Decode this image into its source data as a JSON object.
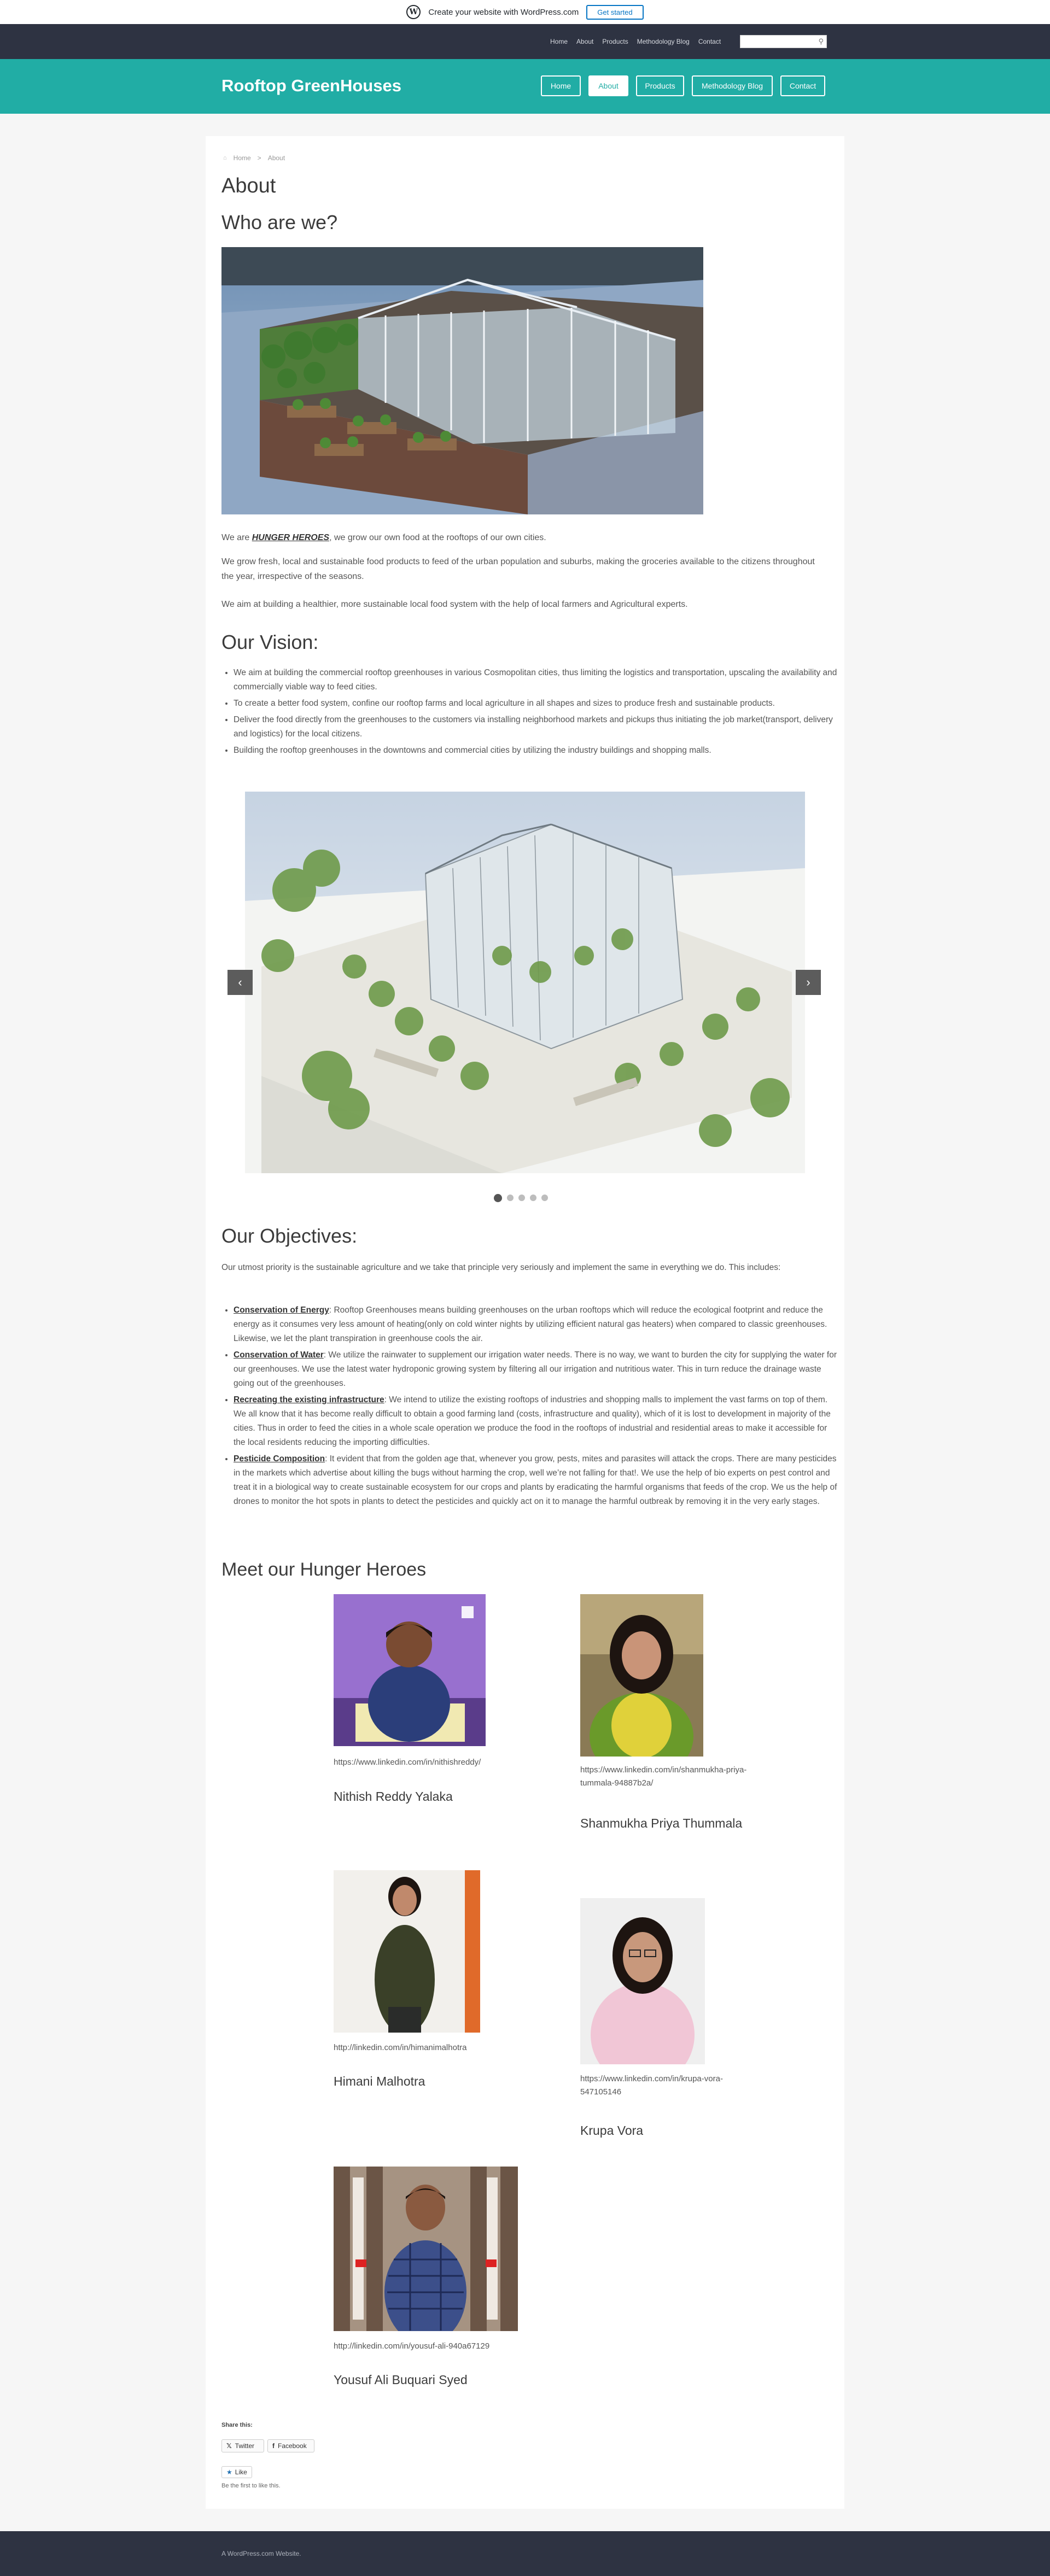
{
  "wpbar": {
    "logo": "W",
    "text": "Create your website with WordPress.com",
    "button": "Get started"
  },
  "topnav": {
    "links": [
      "Home",
      "About",
      "Products",
      "Methodology Blog",
      "Contact"
    ],
    "search_icon": "search-icon"
  },
  "header": {
    "title": "Rooftop GreenHouses",
    "menu": [
      "Home",
      "About",
      "Products",
      "Methodology Blog",
      "Contact"
    ],
    "active": "About"
  },
  "breadcrumb": {
    "home": "Home",
    "separator": ">",
    "current": "About"
  },
  "page": {
    "title": "About",
    "who_heading": "Who are we?",
    "intro_pre": "We are ",
    "intro_strong": "HUNGER HEROES",
    "intro_post": ", we grow our own food at the rooftops of our own cities.",
    "para2": "We grow fresh, local and sustainable food products to feed of the urban population and suburbs, making the groceries available to the citizens throughout the year, irrespective of the seasons.",
    "para3": "We aim at building a healthier, more sustainable local food system with the help of local farmers and Agricultural experts."
  },
  "vision": {
    "heading": "Our Vision:",
    "items": [
      "We aim at building the commercial rooftop greenhouses in various Cosmopolitan cities, thus limiting the logistics and transportation, upscaling the availability and commercially viable way to feed cities.",
      "To create a better food system, confine our rooftop farms and local agriculture in all shapes and sizes to produce fresh and sustainable products.",
      "Deliver the food directly from the greenhouses to the customers via installing neighborhood markets and pickups thus initiating the job market(transport, delivery and logistics) for the local citizens.",
      "Building the rooftop greenhouses in the downtowns and commercial cities by utilizing the industry buildings and shopping malls."
    ]
  },
  "slider": {
    "prev": "‹",
    "next": "›",
    "dots": 5,
    "active_dot": 1
  },
  "objectives": {
    "heading": "Our Objectives:",
    "intro": "Our utmost priority is the sustainable agriculture and we take that principle very seriously and implement the same in everything we do. This includes:",
    "items": [
      {
        "title": "Conservation of Energy",
        "text": ": Rooftop Greenhouses means building greenhouses on the urban rooftops which will reduce the ecological footprint and reduce the energy as it consumes very less amount of heating(only on cold winter nights by utilizing efficient natural gas heaters) when compared to classic greenhouses. Likewise, we let the plant transpiration in greenhouse cools the air."
      },
      {
        "title": "Conservation of Water",
        "text": ": We utilize the rainwater to supplement our irrigation water needs. There is no way, we want to burden the city for supplying the water for our greenhouses. We use the latest water hydroponic growing system by filtering all our irrigation and nutritious water. This in turn reduce the drainage waste going out of the greenhouses."
      },
      {
        "title": "Recreating the existing infrastructure",
        "text": ": We intend to utilize the existing rooftops of industries and shopping malls to implement the vast farms on top of them. We all know that it has become really difficult to obtain a good farming land (costs, infrastructure and quality), which of it is lost to development in majority of the cities. Thus in order to feed the cities in a whole scale operation we produce the food in the rooftops of industrial and residential areas to make it accessible for the local residents reducing the importing difficulties."
      },
      {
        "title": "Pesticide Composition",
        "text": ": It evident that from the golden age that, whenever you grow, pests, mites and parasites will attack the crops. There are many pesticides in the markets which advertise about killing the bugs without harming the crop, well we’re not falling for that!. We use the help of bio experts on pest control and treat it in a biological way to create sustainable ecosystem for our crops and plants by eradicating the harmful organisms that feeds of the crop. We us the help of drones to monitor the hot spots in plants to detect the pesticides and quickly act on it to manage the harmful outbreak by removing it in the very early stages."
      }
    ]
  },
  "team": {
    "heading": "Meet our Hunger Heroes",
    "members": [
      {
        "link": "https://www.linkedin.com/in/nithishreddy/",
        "name": "Nithish Reddy Yalaka"
      },
      {
        "link": "https://www.linkedin.com/in/shanmukha-priya-tummala-94887b2a/",
        "name": "Shanmukha Priya Thummala"
      },
      {
        "link": "http://linkedin.com/in/himanimalhotra",
        "name": "Himani Malhotra"
      },
      {
        "link": "https://www.linkedin.com/in/krupa-vora-547105146",
        "name": "Krupa Vora"
      },
      {
        "link": "http://linkedin.com/in/yousuf-ali-940a67129",
        "name": "Yousuf Ali Buquari Syed"
      }
    ]
  },
  "share": {
    "label": "Share this:",
    "twitter": "Twitter",
    "facebook": "Facebook"
  },
  "like": {
    "button": "Like",
    "note": "Be the first to like this."
  },
  "footer": {
    "text": "A WordPress.com Website."
  }
}
